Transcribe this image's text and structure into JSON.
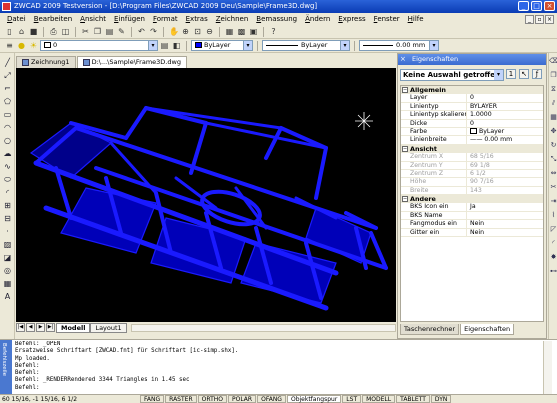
{
  "window": {
    "title": "ZWCAD 2009 Testversion - [D:\\Program Files\\ZWCAD 2009 Deu\\Sample\\Frame3D.dwg]",
    "controls": [
      "_",
      "□",
      "×"
    ]
  },
  "menu": {
    "items": [
      {
        "key": "D",
        "rest": "atei"
      },
      {
        "key": "B",
        "rest": "earbeiten"
      },
      {
        "key": "A",
        "rest": "nsicht"
      },
      {
        "key": "E",
        "rest": "infügen"
      },
      {
        "key": "F",
        "rest": "ormat"
      },
      {
        "key": "E",
        "rest": "xtras"
      },
      {
        "key": "Z",
        "rest": "eichnen"
      },
      {
        "key": "B",
        "rest": "emassung"
      },
      {
        "key": "Ä",
        "rest": "ndern"
      },
      {
        "key": "E",
        "rest": "xpress"
      },
      {
        "key": "F",
        "rest": "enster"
      },
      {
        "key": "H",
        "rest": "ilfe"
      }
    ]
  },
  "toolbar2": {
    "layer_value": "0",
    "color_value": "ByLayer",
    "linetype_value": "ByLayer",
    "lineweight_value": "0.00 mm"
  },
  "doc_tabs": [
    {
      "label": "Zeichnung1"
    },
    {
      "label": "D:\\...\\Sample\\Frame3D.dwg"
    }
  ],
  "layout_tabs": [
    "Modell",
    "Layout1"
  ],
  "properties": {
    "header": "Eigenschaften",
    "selection": "Keine Auswahl getroffen",
    "categories": [
      {
        "name": "Allgemein",
        "rows": [
          {
            "key": "Layer",
            "value": "0"
          },
          {
            "key": "Linientyp",
            "value": "BYLAYER"
          },
          {
            "key": "Linientyp skalieren",
            "value": "1.0000"
          },
          {
            "key": "Dicke",
            "value": "0"
          },
          {
            "key": "Farbe",
            "value": "ByLayer"
          },
          {
            "key": "Linienbreite",
            "value": "—— 0.00 mm"
          }
        ]
      },
      {
        "name": "Ansicht",
        "rows": [
          {
            "key": "Zentrum X",
            "value": "68 5/16",
            "disabled": true
          },
          {
            "key": "Zentrum Y",
            "value": "69 1/8",
            "disabled": true
          },
          {
            "key": "Zentrum Z",
            "value": "6 1/2",
            "disabled": true
          },
          {
            "key": "Höhe",
            "value": "90 7/16",
            "disabled": true
          },
          {
            "key": "Breite",
            "value": "143",
            "disabled": true
          }
        ]
      },
      {
        "name": "Andere",
        "rows": [
          {
            "key": "BKS Icon ein",
            "value": "Ja"
          },
          {
            "key": "BKS Name",
            "value": ""
          },
          {
            "key": "Fangmodus ein",
            "value": "Nein"
          },
          {
            "key": "Gitter ein",
            "value": "Nein"
          }
        ]
      }
    ],
    "tabs": [
      "Taschenrechner",
      "Eigenschaften"
    ]
  },
  "command_panel": {
    "grip_label": "Befehlszeile",
    "lines": [
      "Befehl: _OPEN",
      "Ersatzweise Schriftart [ZWCAD.fnt] für Schriftart [ic-simp.shx].",
      "Mp loaded.",
      "Befehl:",
      "Befehl:",
      "Befehl: _RENDERRendered 3344 Triangles in 1.45 sec",
      "Befehl:"
    ]
  },
  "status": {
    "coords": "60 15/16,  -1 15/16,  6 1/2",
    "buttons": [
      {
        "label": "FANG",
        "on": false
      },
      {
        "label": "RASTER",
        "on": false
      },
      {
        "label": "ORTHO",
        "on": false
      },
      {
        "label": "POLAR",
        "on": false
      },
      {
        "label": "OFANG",
        "on": false
      },
      {
        "label": "Objektfangspur",
        "on": true
      },
      {
        "label": "LST",
        "on": false
      },
      {
        "label": "MODELL",
        "on": false
      },
      {
        "label": "TABLETT",
        "on": false
      },
      {
        "label": "DYN",
        "on": false
      }
    ]
  },
  "colors": {
    "model_wire": "#1a1aff",
    "model_face": "#0000b8",
    "viewport_bg": "#000000",
    "title_bar": "#0a3cb4"
  }
}
